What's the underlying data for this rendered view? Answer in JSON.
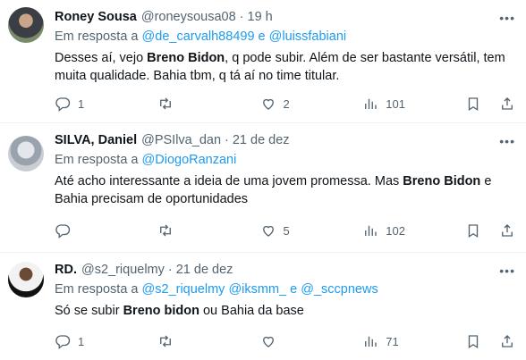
{
  "tweets": [
    {
      "name": "Roney Sousa",
      "handle": "@roneysousa08",
      "time": "19 h",
      "reply_prefix": "Em resposta a",
      "mention1": "@de_carvalh88499",
      "joiner": "e",
      "mention2": "@luissfabiani",
      "text_parts": [
        "Desses aí, vejo ",
        "Breno Bidon",
        ", q pode subir. Além de ser bastante versátil, tem muita qualidade. Bahia tbm, q tá aí no time titular."
      ],
      "replies": "1",
      "retweets": "",
      "likes": "2",
      "views": "101"
    },
    {
      "name": "SILVA, Daniel",
      "handle": "@PSIlva_dan",
      "time": "21 de dez",
      "reply_prefix": "Em resposta a",
      "mention1": "@DiogoRanzani",
      "text_parts": [
        "Até acho interessante a ideia de uma jovem promessa. Mas ",
        "Breno Bidon",
        " e Bahia precisam de oportunidades"
      ],
      "replies": "",
      "retweets": "",
      "likes": "5",
      "views": "102"
    },
    {
      "name": "RD.",
      "handle": "@s2_riquelmy",
      "time": "21 de dez",
      "reply_prefix": "Em resposta a",
      "mention1": "@s2_riquelmy",
      "mention2": "@iksmm_",
      "joiner": "e",
      "mention3": "@_sccpnews",
      "text_parts": [
        "Só se subir ",
        "Breno bidon",
        " ou Bahia da base"
      ],
      "replies": "1",
      "retweets": "",
      "likes": "",
      "views": "71"
    }
  ],
  "icons": [
    "reply-icon",
    "retweet-icon",
    "like-icon",
    "views-icon",
    "bookmark-icon",
    "share-icon",
    "more-icon"
  ],
  "colors": {
    "text": "#0f1419",
    "secondary": "#536471",
    "link": "#1d9bf0",
    "divider": "#eff3f4"
  }
}
